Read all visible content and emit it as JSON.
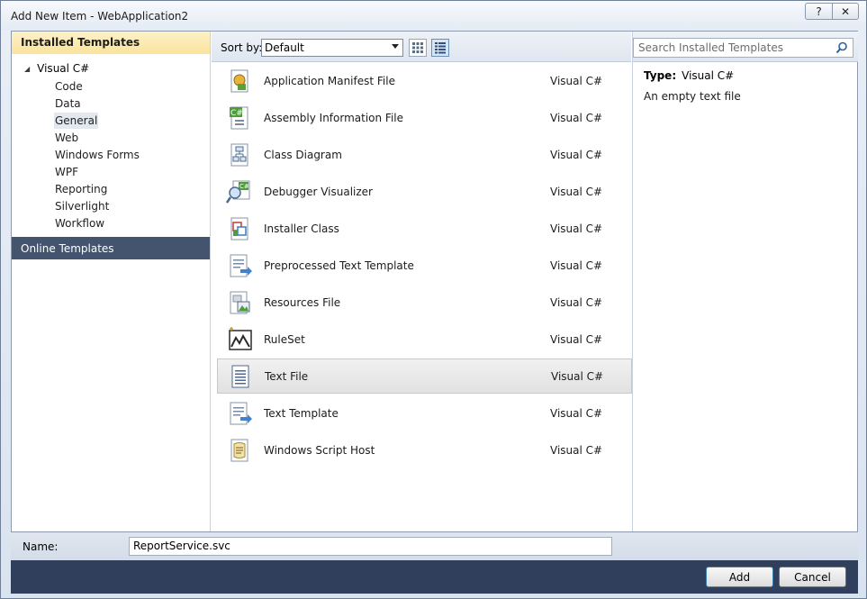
{
  "window": {
    "title": "Add New Item - WebApplication2",
    "help_label": "?",
    "close_label": "✕"
  },
  "left": {
    "installed_label": "Installed Templates",
    "root_label": "Visual C#",
    "items": [
      "Code",
      "Data",
      "General",
      "Web",
      "Windows Forms",
      "WPF",
      "Reporting",
      "Silverlight",
      "Workflow"
    ],
    "selected_item": "General",
    "online_label": "Online Templates"
  },
  "toolbar": {
    "sort_label": "Sort by:",
    "sort_value": "Default"
  },
  "search": {
    "placeholder": "Search Installed Templates"
  },
  "templates": [
    {
      "name": "Application Manifest File",
      "lang": "Visual C#",
      "icon": "manifest-icon"
    },
    {
      "name": "Assembly Information File",
      "lang": "Visual C#",
      "icon": "assembly-info-icon"
    },
    {
      "name": "Class Diagram",
      "lang": "Visual C#",
      "icon": "class-diagram-icon"
    },
    {
      "name": "Debugger Visualizer",
      "lang": "Visual C#",
      "icon": "debugger-visualizer-icon"
    },
    {
      "name": "Installer Class",
      "lang": "Visual C#",
      "icon": "installer-class-icon"
    },
    {
      "name": "Preprocessed Text Template",
      "lang": "Visual C#",
      "icon": "preprocessed-template-icon"
    },
    {
      "name": "Resources File",
      "lang": "Visual C#",
      "icon": "resources-file-icon"
    },
    {
      "name": "RuleSet",
      "lang": "Visual C#",
      "icon": "ruleset-icon"
    },
    {
      "name": "Text File",
      "lang": "Visual C#",
      "icon": "text-file-icon"
    },
    {
      "name": "Text Template",
      "lang": "Visual C#",
      "icon": "text-template-icon"
    },
    {
      "name": "Windows Script Host",
      "lang": "Visual C#",
      "icon": "script-host-icon"
    }
  ],
  "selected_template": "Text File",
  "details": {
    "type_label": "Type:",
    "type_value": "Visual C#",
    "description": "An empty text file"
  },
  "name_field": {
    "label": "Name:",
    "value": "ReportService.svc"
  },
  "buttons": {
    "add": "Add",
    "cancel": "Cancel"
  }
}
